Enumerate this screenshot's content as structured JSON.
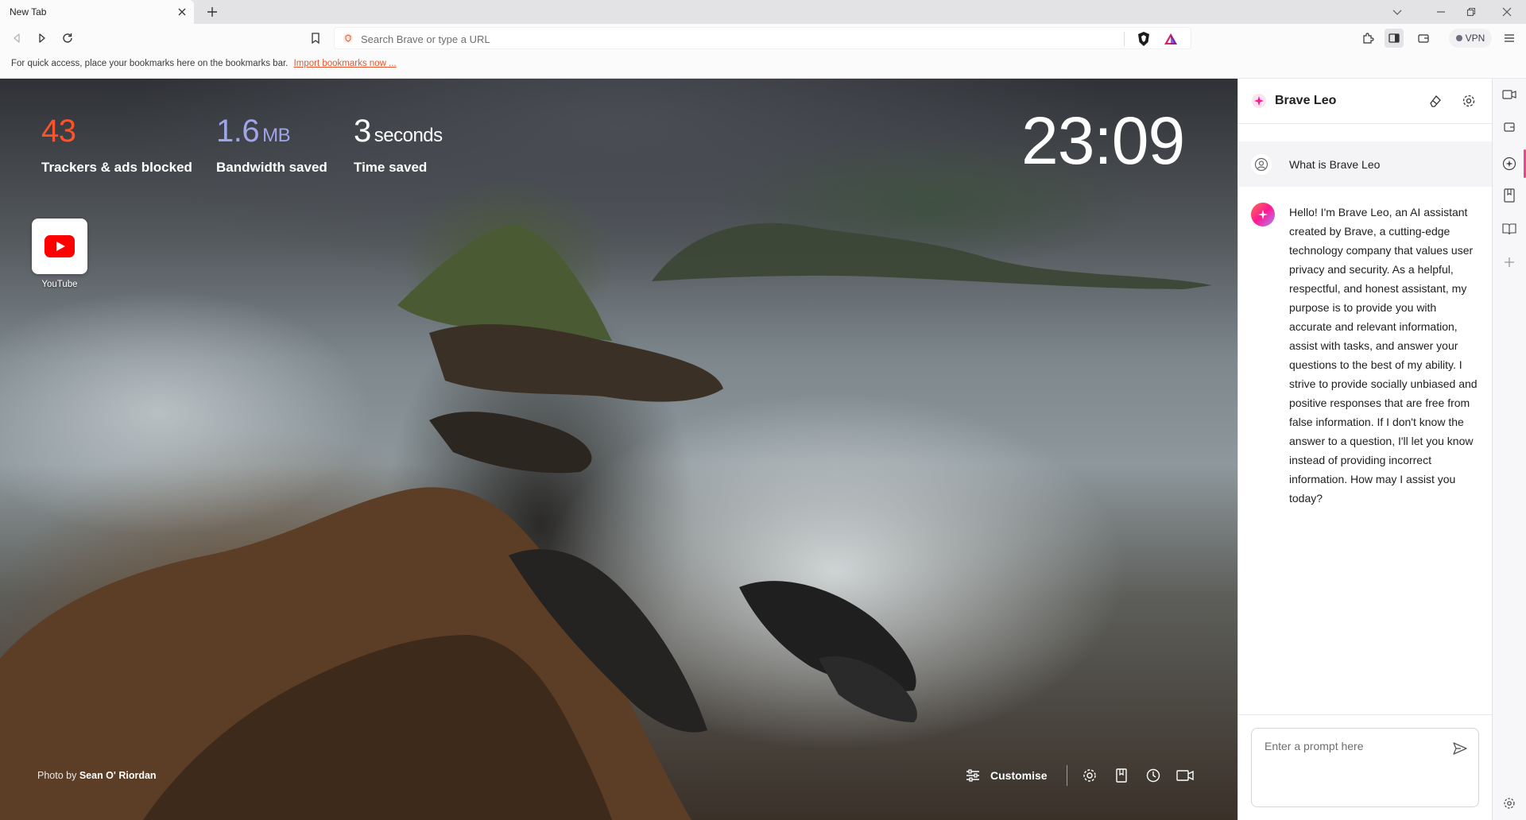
{
  "tab": {
    "title": "New Tab"
  },
  "omnibox": {
    "placeholder": "Search Brave or type a URL"
  },
  "toolbar": {
    "vpn_label": "VPN"
  },
  "bookmarks_bar": {
    "message": "For quick access, place your bookmarks here on the bookmarks bar.",
    "import_link": "Import bookmarks now ..."
  },
  "stats": {
    "trackers": {
      "value": "43",
      "label": "Trackers & ads blocked",
      "color": "#fb542b"
    },
    "bandwidth": {
      "value": "1.6",
      "unit": "MB",
      "label": "Bandwidth saved",
      "color": "#a0a5eb"
    },
    "time": {
      "value": "3",
      "unit": "seconds",
      "label": "Time saved"
    }
  },
  "clock": "23:09",
  "top_sites": [
    {
      "label": "YouTube",
      "icon": "youtube-icon"
    }
  ],
  "photo_credit": {
    "prefix": "Photo by",
    "author": "Sean O' Riordan"
  },
  "footer": {
    "customise_label": "Customise"
  },
  "leo": {
    "title": "Brave Leo",
    "question": "What is Brave Leo",
    "answer": "Hello! I'm Brave Leo, an AI assistant created by Brave, a cutting-edge technology company that values user privacy and security. As a helpful, respectful, and honest assistant, my purpose is to provide you with accurate and relevant information, assist with tasks, and answer your questions to the best of my ability. I strive to provide socially unbiased and positive responses that are free from false information. If I don't know the answer to a question, I'll let you know instead of providing incorrect information. How may I assist you today?",
    "input_placeholder": "Enter a prompt here"
  },
  "colors": {
    "accent": "#fb542b",
    "leo_pink": "#ff1893",
    "sidebar_active": "#e5488b"
  }
}
